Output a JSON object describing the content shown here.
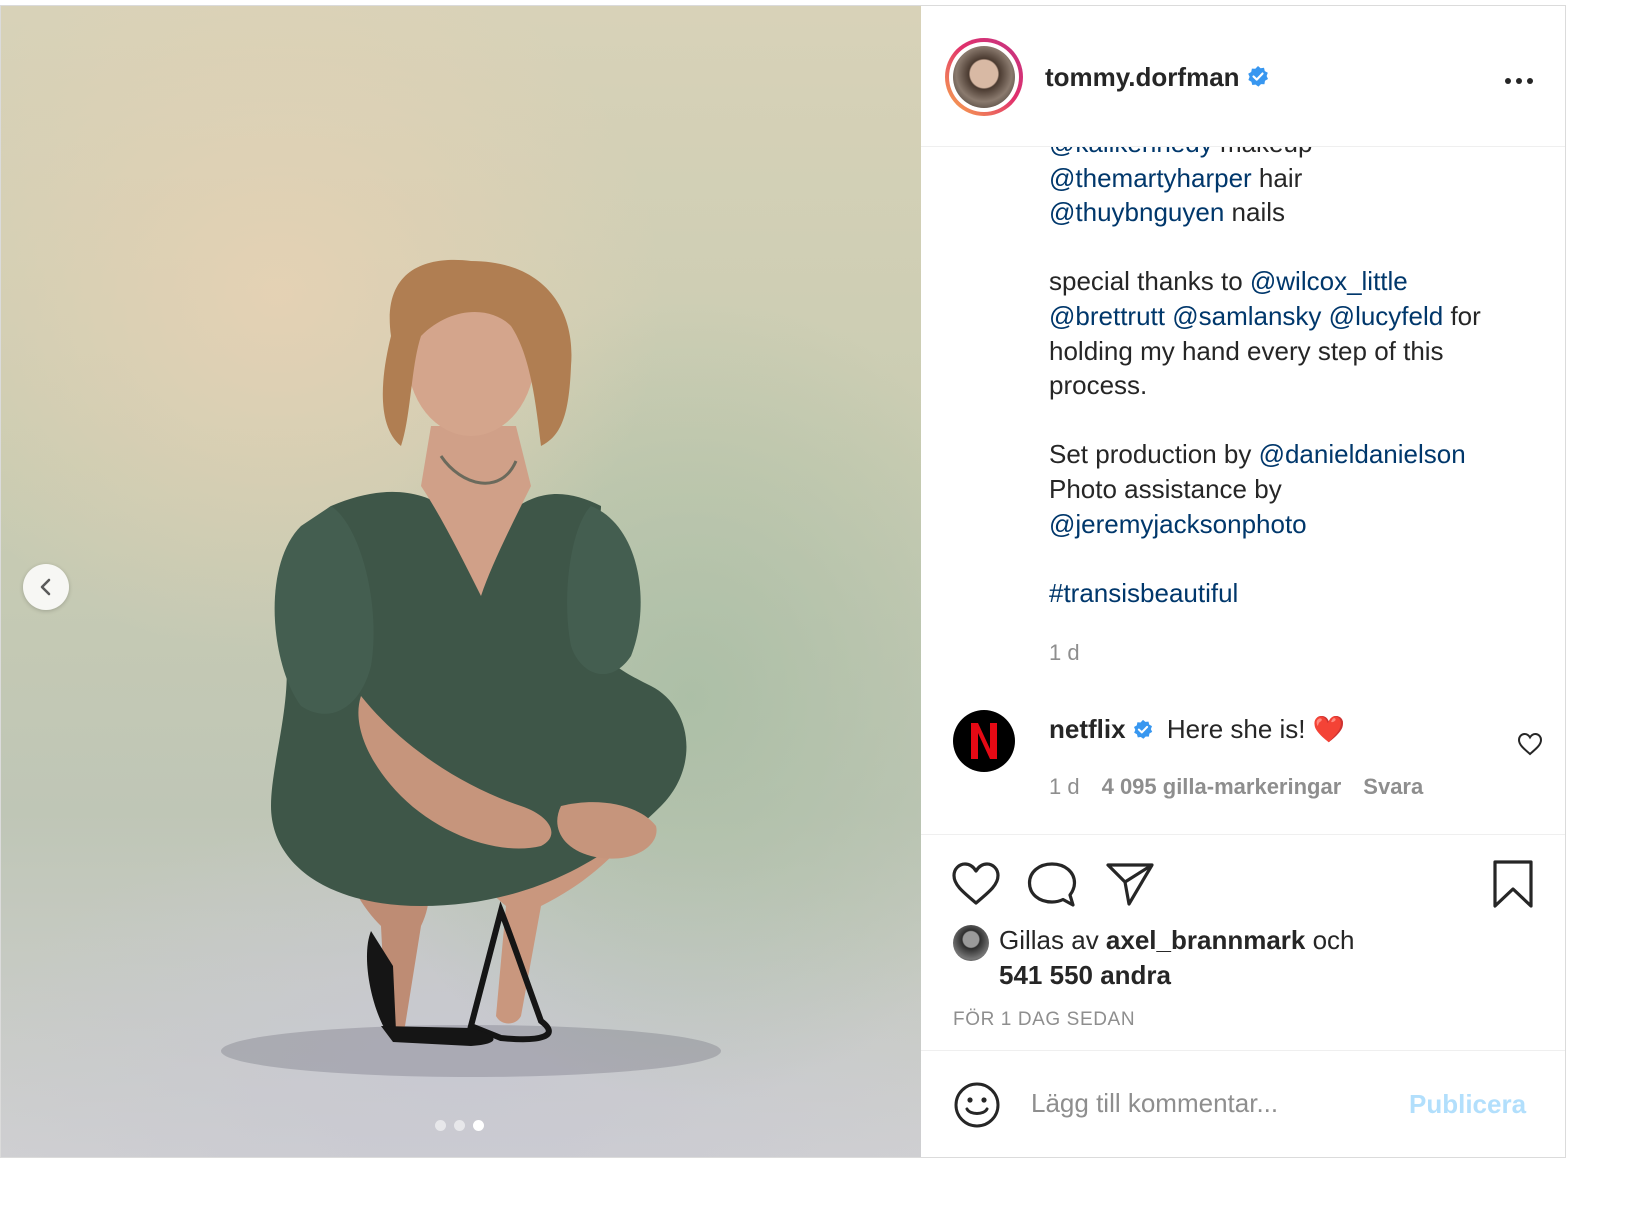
{
  "header": {
    "username": "tommy.dorfman",
    "verified": true
  },
  "caption": {
    "lines": [
      [
        {
          "text": "@kalikennedy",
          "mention": true
        },
        {
          "text": " makeup"
        }
      ],
      [
        {
          "text": "@themartyharper",
          "mention": true
        },
        {
          "text": " hair"
        }
      ],
      [
        {
          "text": "@thuybnguyen",
          "mention": true
        },
        {
          "text": " nails"
        }
      ],
      [],
      [
        {
          "text": "special thanks to "
        },
        {
          "text": "@wilcox_little",
          "mention": true
        }
      ],
      [
        {
          "text": "@brettrutt",
          "mention": true
        },
        {
          "text": " "
        },
        {
          "text": "@samlansky",
          "mention": true
        },
        {
          "text": " "
        },
        {
          "text": "@lucyfeld",
          "mention": true
        },
        {
          "text": " for"
        }
      ],
      [
        {
          "text": "holding my hand every step of this"
        }
      ],
      [
        {
          "text": "process."
        }
      ],
      [],
      [
        {
          "text": "Set production by "
        },
        {
          "text": "@danieldanielson",
          "mention": true
        }
      ],
      [
        {
          "text": "Photo assistance by"
        }
      ],
      [
        {
          "text": "@jeremyjacksonphoto",
          "mention": true
        }
      ],
      [],
      [
        {
          "text": "#transisbeautiful",
          "mention": true
        }
      ]
    ],
    "time": "1 d"
  },
  "comment": {
    "username": "netflix",
    "text": "Here she is! ❤️",
    "time": "1 d",
    "likes": "4 095 gilla-markeringar",
    "reply": "Svara"
  },
  "likes": {
    "prefix": "Gillas av ",
    "user": "axel_brannmark",
    "middle": " och",
    "others": "541 550 andra"
  },
  "date": "FÖR 1 DAG SEDAN",
  "add_comment": {
    "placeholder": "Lägg till kommentar...",
    "publish": "Publicera"
  },
  "carousel": {
    "count": 3,
    "active_index": 2
  },
  "colors": {
    "mention": "#00376b",
    "muted": "#8e8e8e",
    "publish_disabled": "#b2dffc",
    "verified": "#3897f0",
    "heart": "#ed4956",
    "netflix_red": "#e50914"
  }
}
